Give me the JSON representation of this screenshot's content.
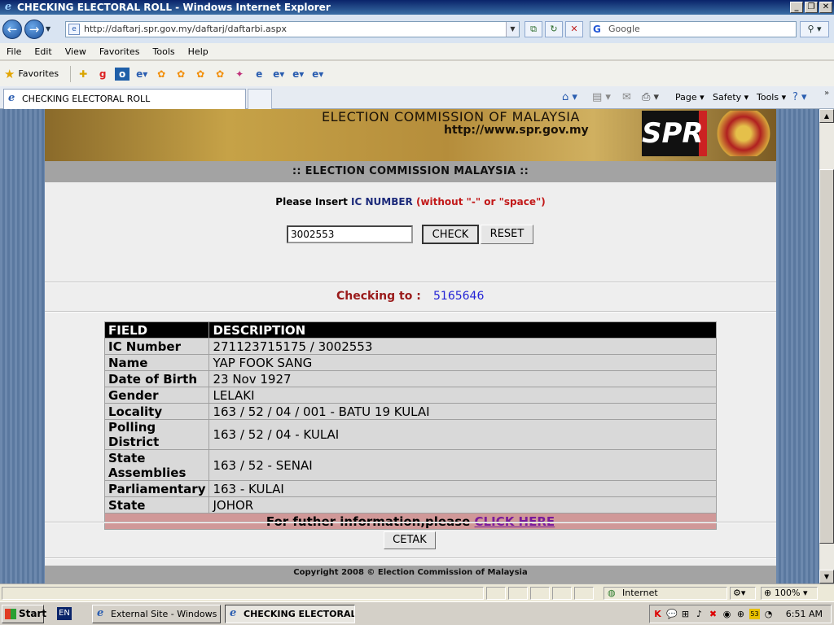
{
  "window": {
    "title": "CHECKING ELECTORAL ROLL - Windows Internet Explorer"
  },
  "address_bar": {
    "url": "http://daftarj.spr.gov.my/daftarj/daftarbi.aspx",
    "search_placeholder": "Google"
  },
  "menu": [
    "File",
    "Edit",
    "View",
    "Favorites",
    "Tools",
    "Help"
  ],
  "favorites_label": "Favorites",
  "tabs": [
    {
      "label": "CHECKING ELECTORAL ROLL"
    }
  ],
  "command_bar": {
    "page": "Page",
    "safety": "Safety",
    "tools": "Tools"
  },
  "banner": {
    "title": "ELECTION COMMISSION OF MALAYSIA",
    "url": "http://www.spr.gov.my",
    "logo_text": "SPR"
  },
  "heading": ":: ELECTION COMMISSION MALAYSIA ::",
  "instruction": {
    "prefix": "Please Insert ",
    "ic": "IC NUMBER",
    "suffix": " (without \"-\" or \"space\")"
  },
  "form": {
    "ic_value": "3002553",
    "check_label": "CHECK",
    "reset_label": "RESET"
  },
  "checking": {
    "label": "Checking to :",
    "value": "5165646"
  },
  "table": {
    "headers": [
      "FIELD",
      "DESCRIPTION"
    ],
    "rows": [
      {
        "field": "IC Number",
        "desc": "271123715175 / 3002553"
      },
      {
        "field": "Name",
        "desc": "YAP FOOK SANG"
      },
      {
        "field": "Date of Birth",
        "desc": "23 Nov 1927"
      },
      {
        "field": "Gender",
        "desc": "LELAKI"
      },
      {
        "field": "Locality",
        "desc": "163 / 52 / 04 / 001 - BATU 19 KULAI"
      },
      {
        "field": "Polling District",
        "desc": "163 / 52 / 04 - KULAI"
      },
      {
        "field": "State Assemblies",
        "desc": "163 / 52 - SENAI"
      },
      {
        "field": "Parliamentary",
        "desc": "163 - KULAI"
      },
      {
        "field": "State",
        "desc": "JOHOR"
      }
    ],
    "footer_text": "For futher information,please ",
    "footer_link": "CLICK HERE"
  },
  "print_label": "CETAK",
  "copyright": "Copyright 2008 © Election Commission of Malaysia",
  "status": {
    "zone": "Internet",
    "zoom": "100%"
  },
  "taskbar": {
    "start": "Start",
    "lang": "EN",
    "items": [
      "External Site - Windows ...",
      "CHECKING ELECTORAL ..."
    ],
    "clock": "6:51 AM"
  },
  "colors": {
    "banner_band": "#a3a3a3",
    "table_header": "#000000",
    "footer_row": "#d09898",
    "checking_label": "#9a1b1b",
    "checking_value": "#2424d6"
  }
}
